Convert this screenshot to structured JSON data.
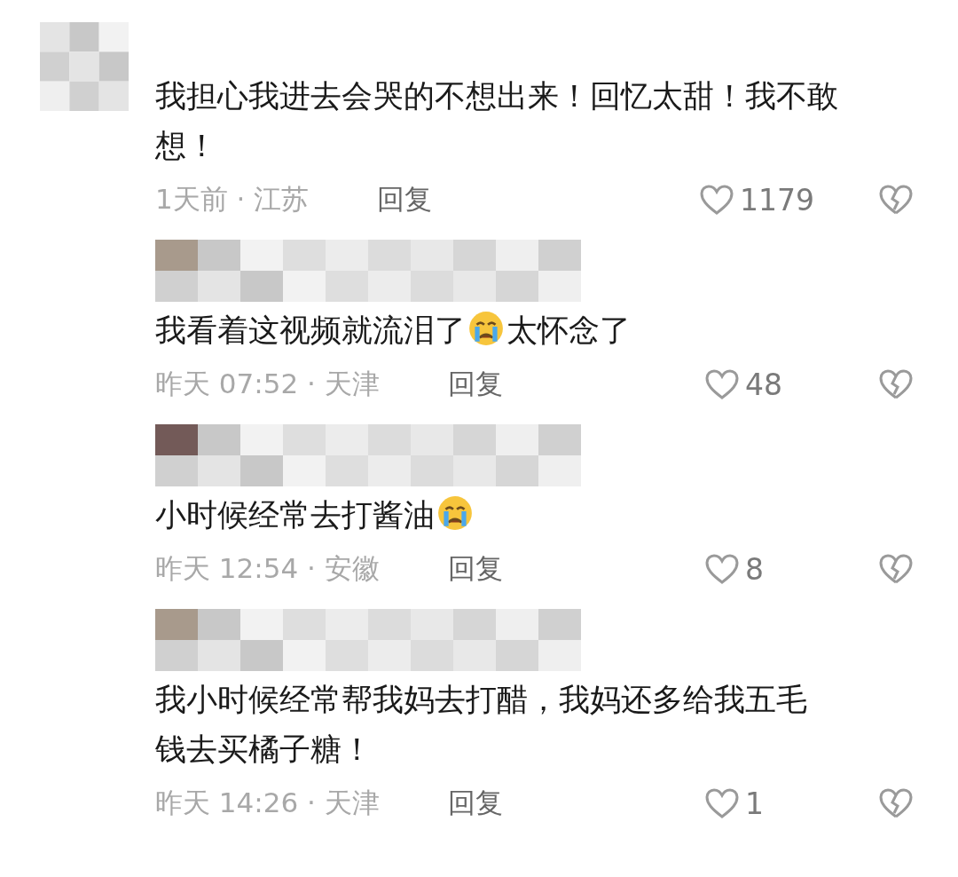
{
  "comment": {
    "segments": [
      {
        "kind": "text",
        "text": "我担心我进去会哭的不想出来！回忆太甜！我不敢想！"
      }
    ],
    "meta": "1天前 · 江苏",
    "reply_label": "回复",
    "likes": "1179",
    "replies": [
      {
        "segments": [
          {
            "kind": "text",
            "text": "我看着这视频就流泪了"
          },
          {
            "kind": "emoji"
          },
          {
            "kind": "text",
            "text": "太怀念了"
          }
        ],
        "meta": "昨天 07:52 · 天津",
        "reply_label": "回复",
        "likes": "48"
      },
      {
        "segments": [
          {
            "kind": "text",
            "text": "小时候经常去打酱油"
          },
          {
            "kind": "emoji"
          }
        ],
        "meta": "昨天 12:54 · 安徽",
        "reply_label": "回复",
        "likes": "8"
      },
      {
        "segments": [
          {
            "kind": "text",
            "text": "我小时候经常帮我妈去打醋，我妈还多给我五毛钱去买橘子糖！"
          }
        ],
        "meta": "昨天 14:26 · 天津",
        "reply_label": "回复",
        "likes": "1"
      }
    ]
  }
}
